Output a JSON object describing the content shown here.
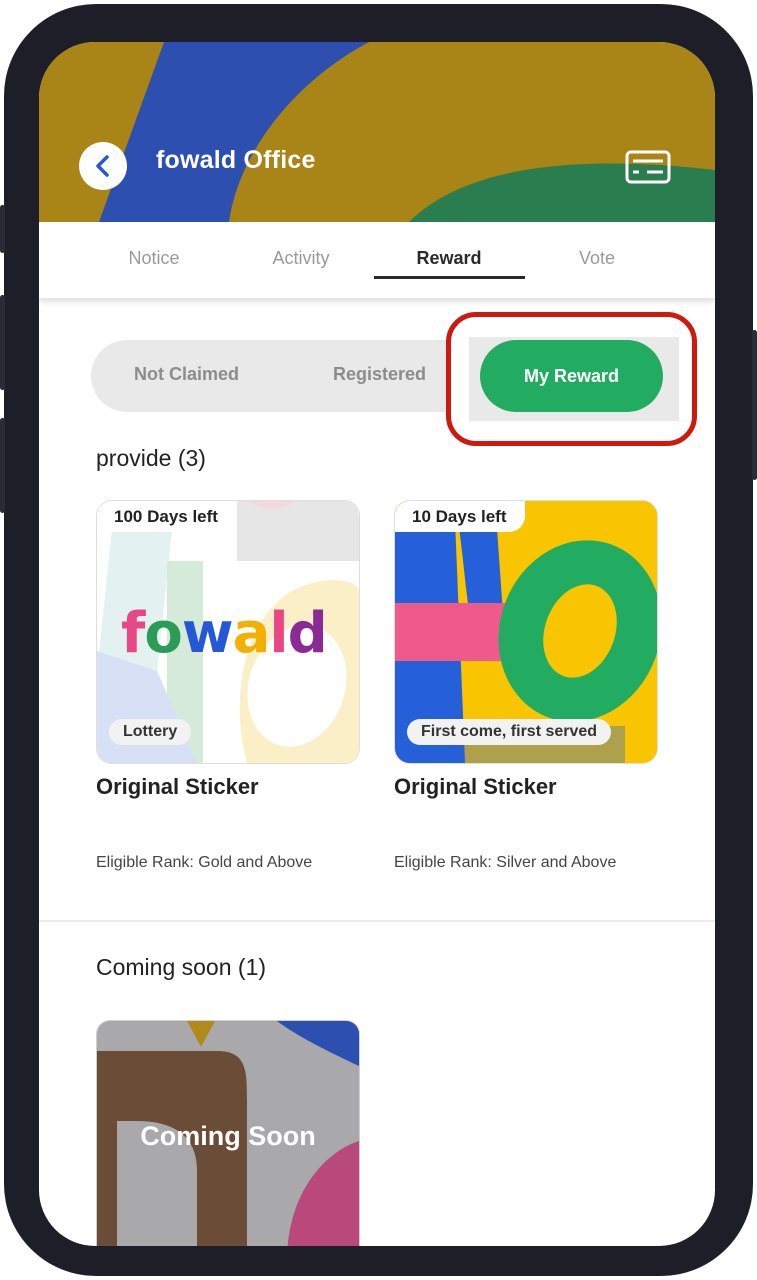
{
  "header": {
    "title": "fowald Office",
    "back_icon": "chevron-left-icon",
    "card_icon": "membership-card-icon"
  },
  "tabs": [
    {
      "label": "Notice"
    },
    {
      "label": "Activity"
    },
    {
      "label": "Reward",
      "active": true
    },
    {
      "label": "Vote"
    }
  ],
  "segments": {
    "not_claimed": "Not Claimed",
    "registered": "Registered",
    "my_reward": "My Reward"
  },
  "provide": {
    "title": "provide (3)",
    "cards": [
      {
        "days_left": "100 Days left",
        "type": "Lottery",
        "name": "Original Sticker",
        "rank": "Eligible Rank: Gold and Above",
        "logo_text": "fowald"
      },
      {
        "days_left": "10 Days left",
        "type": "First come, first served",
        "name": "Original Sticker",
        "rank": "Eligible Rank: Silver and Above"
      }
    ]
  },
  "coming_soon": {
    "title": "Coming soon (1)",
    "card_label": "Coming Soon"
  },
  "colors": {
    "header_bg": "#a98416",
    "accent_green": "#22ac62",
    "highlight_red": "#cc1a0e",
    "back_icon_blue": "#2458d6"
  }
}
